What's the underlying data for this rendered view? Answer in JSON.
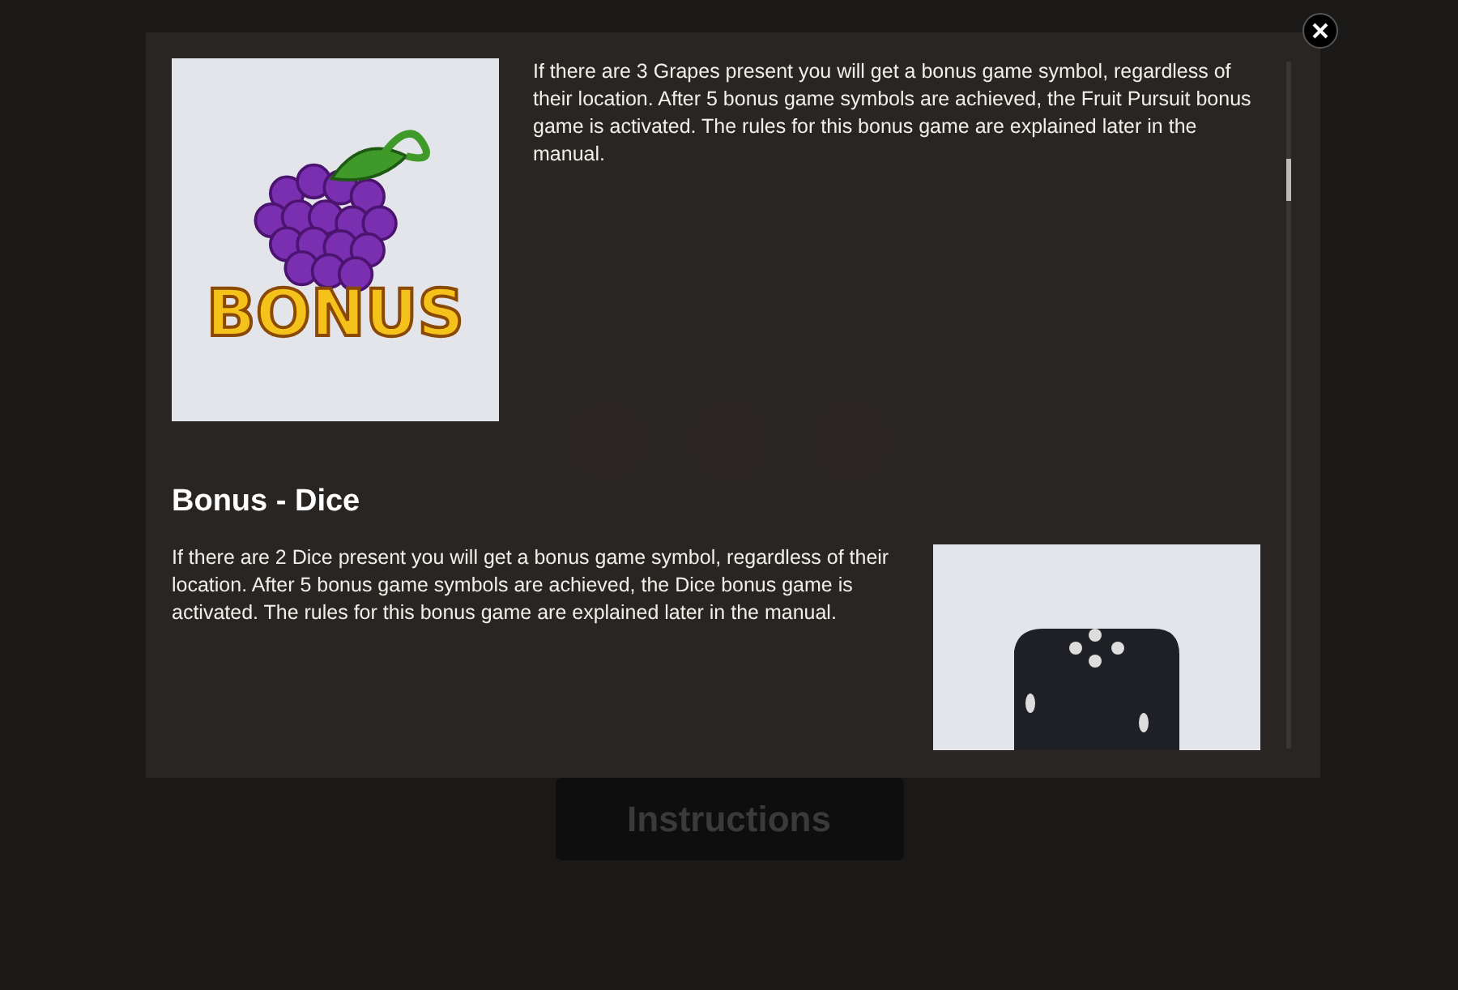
{
  "background": {
    "instructions_button": "Instructions"
  },
  "modal": {
    "sections": [
      {
        "kind": "grapes",
        "symbol_label": "BONUS",
        "text": "If there are 3 Grapes present you will get a bonus game symbol, regardless of their location. After 5 bonus game symbols are achieved, the Fruit Pursuit bonus game is activated. The rules for this bonus game are explained later in the manual."
      },
      {
        "kind": "dice",
        "heading": "Bonus - Dice",
        "text": "If there are 2 Dice present you will get a bonus game symbol, regardless of their location. After 5 bonus game symbols are achieved, the Dice bonus game is activated. The rules for this bonus game are explained later in the manual."
      }
    ]
  }
}
